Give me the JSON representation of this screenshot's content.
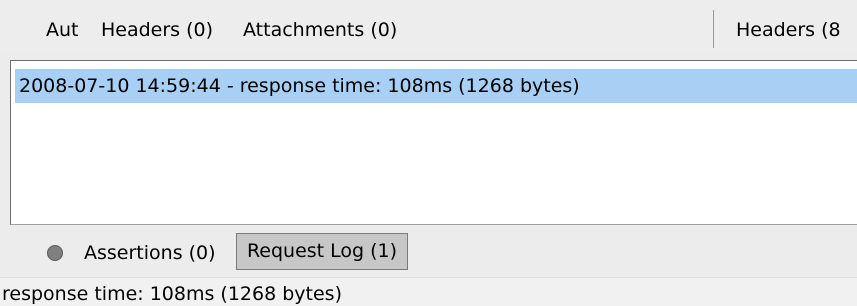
{
  "top_tabs": {
    "aut": "Aut",
    "headers": "Headers (0)",
    "attachments": "Attachments (0)",
    "response_headers": "Headers (8"
  },
  "request_log": {
    "entries": [
      "2008-07-10 14:59:44 - response time: 108ms (1268 bytes)"
    ]
  },
  "bottom_tabs": {
    "assertions": "Assertions (0)",
    "request_log": "Request Log (1)"
  },
  "status": {
    "text": "response time: 108ms (1268 bytes)"
  }
}
